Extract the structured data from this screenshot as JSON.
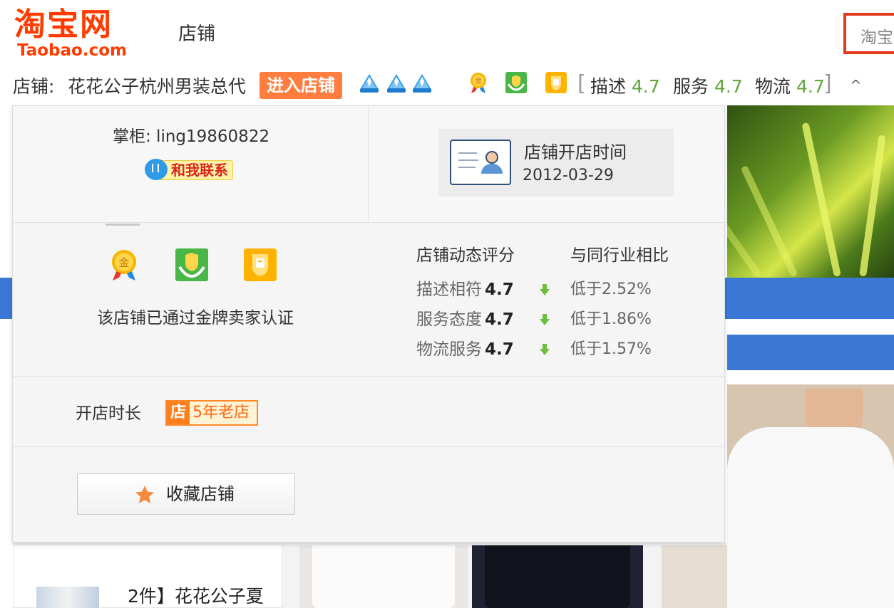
{
  "header": {
    "logo_cn": "淘宝网",
    "logo_en": "Taobao.com",
    "site_tab": "店铺",
    "search_placeholder": "淘宝"
  },
  "shopbar": {
    "label": "店铺:",
    "shop_name": "花花公子杭州男装总代",
    "enter_button": "进入店铺",
    "crown_icons": [
      "crown-icon",
      "crown-icon",
      "crown-icon"
    ],
    "badge_icons": [
      "gold-medal-icon",
      "shield-hands-icon",
      "bell-shield-icon"
    ],
    "ratings": [
      {
        "label": "描述",
        "value": "4.7"
      },
      {
        "label": "服务",
        "value": "4.7"
      },
      {
        "label": "物流",
        "value": "4.7"
      }
    ],
    "bracket_open": "[",
    "bracket_close": "]",
    "collapse": "^"
  },
  "popup": {
    "keeper": "掌柜: ling19860822",
    "contact_button": "和我联系",
    "open_title": "店铺开店时间",
    "open_date": "2012-03-29",
    "cert_text": "该店铺已通过金牌卖家认证",
    "score_head": "店铺动态评分",
    "compare_head": "与同行业相比",
    "scores": [
      {
        "label": "描述相符",
        "value": "4.7",
        "compare": "低于2.52%"
      },
      {
        "label": "服务态度",
        "value": "4.7",
        "compare": "低于1.86%"
      },
      {
        "label": "物流服务",
        "value": "4.7",
        "compare": "低于1.57%"
      }
    ],
    "duration_label": "开店时长",
    "duration_icon_text": "店",
    "duration_text": "5年老店",
    "favorite_button": "收藏店铺"
  },
  "background": {
    "product_title": "2件】花花公子夏"
  },
  "colors": {
    "brand": "#ff3b00",
    "accent_orange": "#ff7d3f",
    "rating_green": "#5fa53a",
    "band_blue": "#3b78d6"
  }
}
